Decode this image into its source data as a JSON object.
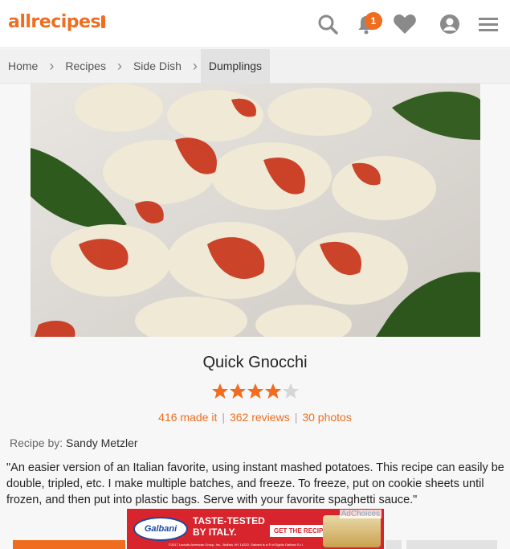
{
  "header": {
    "logo": "allrecipes",
    "notification_count": "1"
  },
  "breadcrumb": [
    "Home",
    "Recipes",
    "Side Dish",
    "Dumplings"
  ],
  "recipe": {
    "title": "Quick Gnocchi",
    "rating": 4.5,
    "made_it": "416 made it",
    "reviews": "362 reviews",
    "photos": "30 photos",
    "byline_label": "Recipe by:",
    "author": "Sandy Metzler",
    "description": "\"An easier version of an Italian favorite, using instant mashed potatoes. This recipe can easily be double, tripled, etc. I make multiple batches, and freeze. To freeze, put on cookie sheets until frozen, and then put into plastic bags. Serve with your favorite spaghetti sauce.\""
  },
  "ad": {
    "choices": "AdChoices",
    "brand": "Galbani",
    "headline_1": "TASTE-TESTED",
    "headline_2": "BY ITALY.",
    "cta": "GET THE RECIPE ▶",
    "fine_print": "©2017 Lactalis American Group, Inc., Buffalo, NY 14220. Galbani is a ® of Egidio Galbani S.r.l."
  },
  "colors": {
    "brand": "#f06d1f",
    "star": "#f06d1f"
  }
}
